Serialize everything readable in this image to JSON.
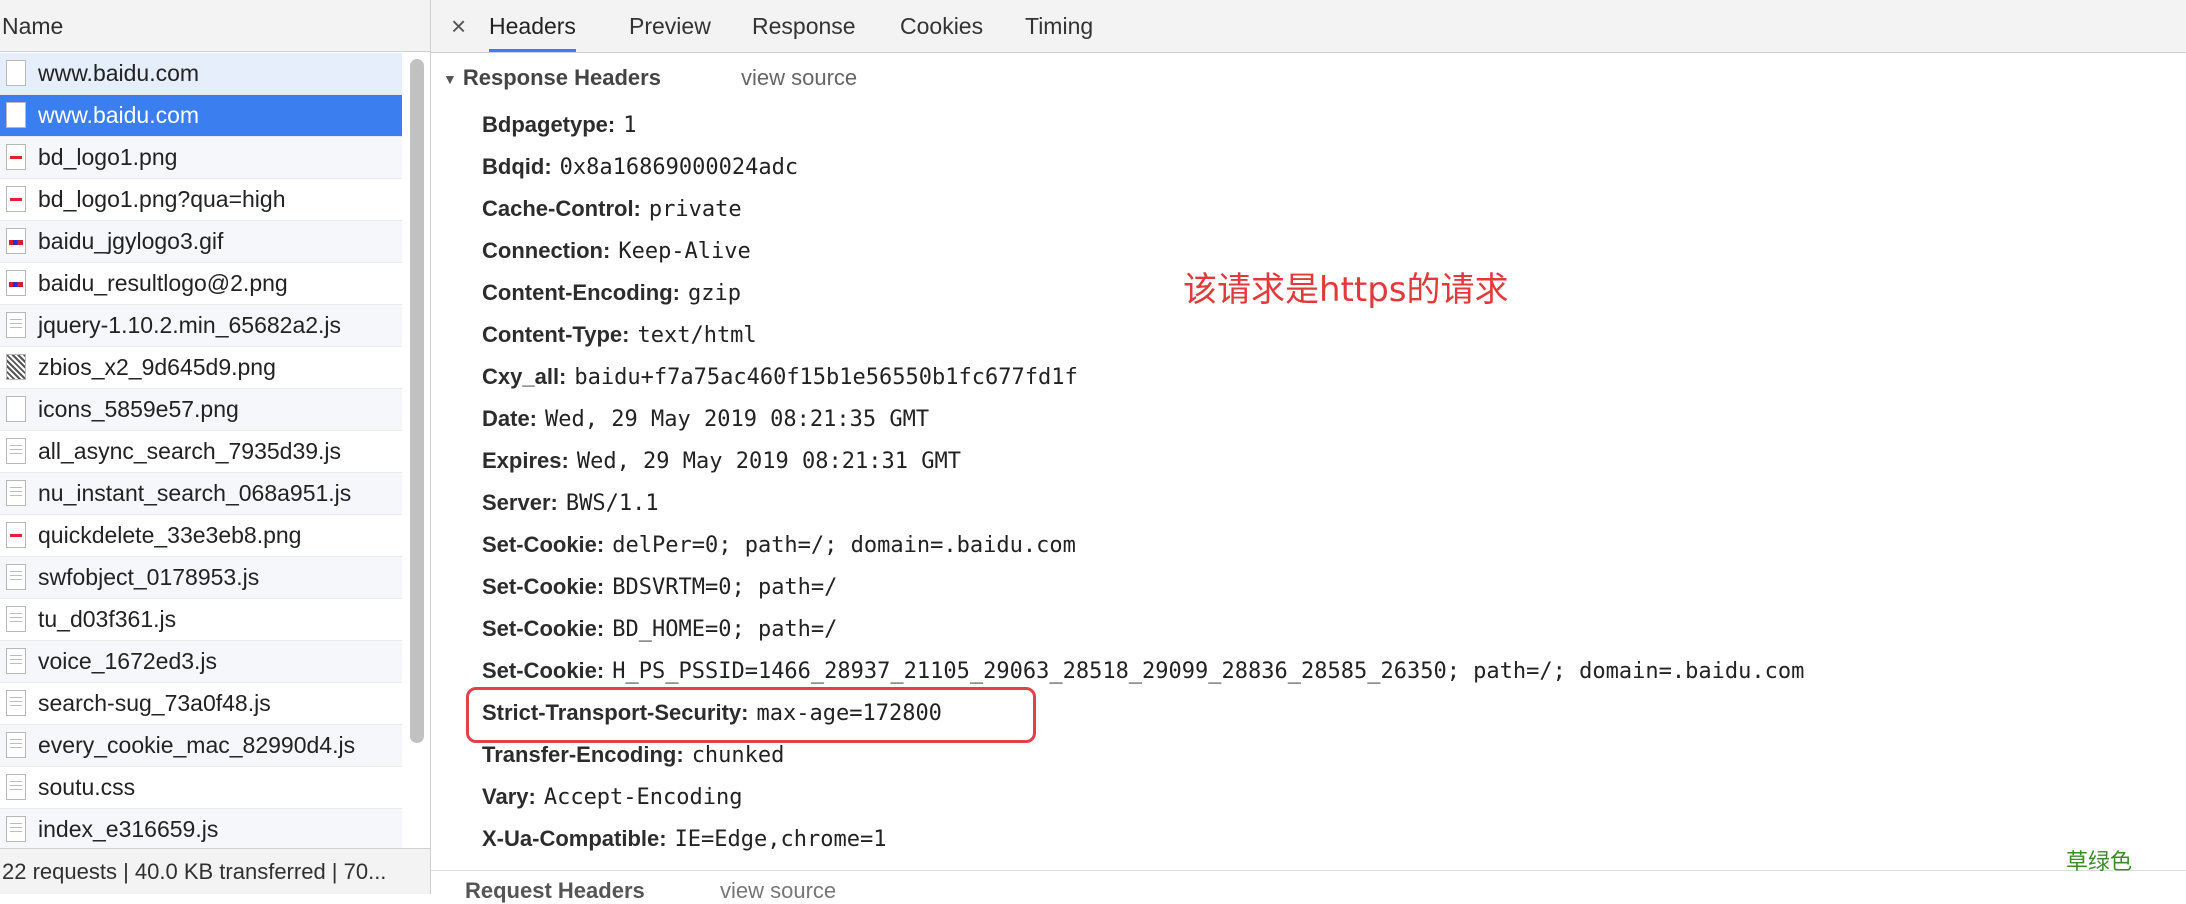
{
  "left_panel": {
    "column_header": "Name",
    "requests": [
      {
        "name": "www.baidu.com",
        "icon": "document-icon"
      },
      {
        "name": "www.baidu.com",
        "icon": "document-icon",
        "selected": true
      },
      {
        "name": "bd_logo1.png",
        "icon": "image-icon"
      },
      {
        "name": "bd_logo1.png?qua=high",
        "icon": "image-icon"
      },
      {
        "name": "baidu_jgylogo3.gif",
        "icon": "gif-icon"
      },
      {
        "name": "baidu_resultlogo@2.png",
        "icon": "gif-icon"
      },
      {
        "name": "jquery-1.10.2.min_65682a2.js",
        "icon": "script-icon"
      },
      {
        "name": "zbios_x2_9d645d9.png",
        "icon": "qr-image-icon"
      },
      {
        "name": "icons_5859e57.png",
        "icon": "document-icon"
      },
      {
        "name": "all_async_search_7935d39.js",
        "icon": "script-icon"
      },
      {
        "name": "nu_instant_search_068a951.js",
        "icon": "script-icon"
      },
      {
        "name": "quickdelete_33e3eb8.png",
        "icon": "image-icon"
      },
      {
        "name": "swfobject_0178953.js",
        "icon": "script-icon"
      },
      {
        "name": "tu_d03f361.js",
        "icon": "script-icon"
      },
      {
        "name": "voice_1672ed3.js",
        "icon": "script-icon"
      },
      {
        "name": "search-sug_73a0f48.js",
        "icon": "script-icon"
      },
      {
        "name": "every_cookie_mac_82990d4.js",
        "icon": "script-icon"
      },
      {
        "name": "soutu.css",
        "icon": "script-icon"
      },
      {
        "name": "index_e316659.js",
        "icon": "script-icon"
      }
    ],
    "status_bar": "22 requests | 40.0 KB transferred | 70..."
  },
  "tabs": {
    "close": "×",
    "items": [
      "Headers",
      "Preview",
      "Response",
      "Cookies",
      "Timing"
    ],
    "active": "Headers"
  },
  "response_headers": {
    "title": "Response Headers",
    "toggle": "▼",
    "view_source": "view source",
    "headers": [
      {
        "key": "Bdpagetype:",
        "value": "1"
      },
      {
        "key": "Bdqid:",
        "value": "0x8a16869000024adc"
      },
      {
        "key": "Cache-Control:",
        "value": "private"
      },
      {
        "key": "Connection:",
        "value": "Keep-Alive"
      },
      {
        "key": "Content-Encoding:",
        "value": "gzip"
      },
      {
        "key": "Content-Type:",
        "value": "text/html"
      },
      {
        "key": "Cxy_all:",
        "value": "baidu+f7a75ac460f15b1e56550b1fc677fd1f"
      },
      {
        "key": "Date:",
        "value": "Wed, 29 May 2019 08:21:35 GMT"
      },
      {
        "key": "Expires:",
        "value": "Wed, 29 May 2019 08:21:31 GMT"
      },
      {
        "key": "Server:",
        "value": "BWS/1.1"
      },
      {
        "key": "Set-Cookie:",
        "value": "delPer=0; path=/; domain=.baidu.com"
      },
      {
        "key": "Set-Cookie:",
        "value": "BDSVRTM=0; path=/"
      },
      {
        "key": "Set-Cookie:",
        "value": "BD_HOME=0; path=/"
      },
      {
        "key": "Set-Cookie:",
        "value": "H_PS_PSSID=1466_28937_21105_29063_28518_29099_28836_28585_26350; path=/; domain=.baidu.com"
      },
      {
        "key": "Strict-Transport-Security:",
        "value": "max-age=172800"
      },
      {
        "key": "Transfer-Encoding:",
        "value": "chunked"
      },
      {
        "key": "Vary:",
        "value": "Accept-Encoding"
      },
      {
        "key": "X-Ua-Compatible:",
        "value": "IE=Edge,chrome=1"
      }
    ]
  },
  "request_headers": {
    "title": "Request Headers",
    "view_source": "view source"
  },
  "annotation": "该请求是https的请求",
  "watermark": "草绿色",
  "colors": {
    "selected_row": "#3a7ef0",
    "highlight_box": "#e1424a",
    "annotation": "#e23a3a"
  }
}
